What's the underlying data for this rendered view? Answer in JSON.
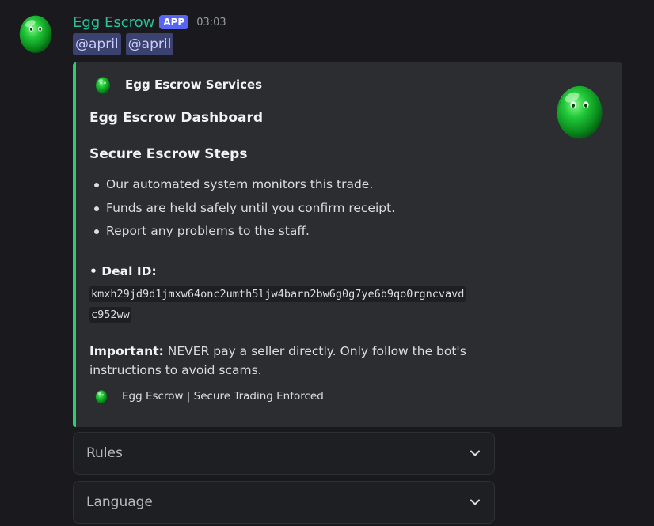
{
  "message": {
    "author": "Egg Escrow",
    "badge": "APP",
    "timestamp": "03:03",
    "avatar_icon": "green-egg-icon",
    "mentions": [
      "@april",
      "@april"
    ]
  },
  "embed": {
    "accent_color": "#2ecc71",
    "author_name": "Egg Escrow Services",
    "title": "Egg Escrow Dashboard",
    "heading": "Secure Escrow Steps",
    "bullets": [
      "Our automated system monitors this trade.",
      "Funds are held safely until you confirm receipt.",
      "Report any problems to the staff."
    ],
    "deal_label": "• Deal ID:",
    "deal_id_line1": "kmxh29jd9d1jmxw64onc2umth5ljw4barn2bw6g0g7ye6b9qo0rgncvavd",
    "deal_id_line2": "c952ww",
    "important_label": "Important:",
    "important_text": " NEVER pay a seller directly. Only follow the bot's instructions to avoid scams.",
    "footer_text": "Egg Escrow | Secure Trading Enforced"
  },
  "selects": [
    {
      "placeholder": "Rules"
    },
    {
      "placeholder": "Language"
    }
  ],
  "colors": {
    "author": "#27c29a",
    "badge": "#5865f2",
    "mention_bg": "#3c4270",
    "embed_bg": "#2b2d31",
    "background": "#1a1a1e"
  }
}
